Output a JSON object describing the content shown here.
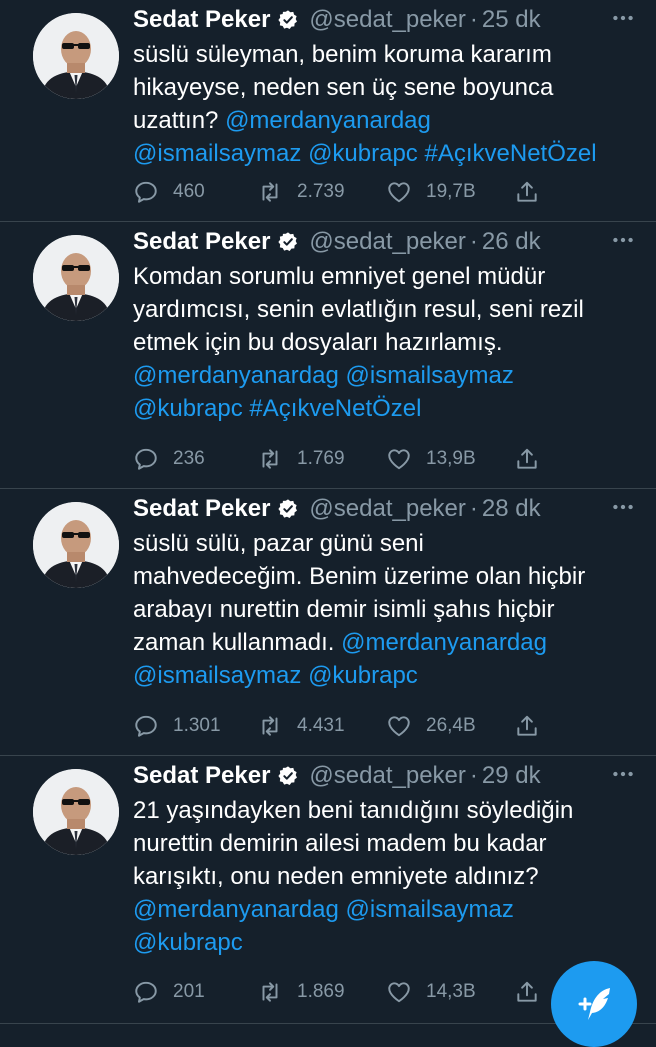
{
  "tweets": [
    {
      "author": {
        "name": "Sedat Peker",
        "handle": "@sedat_peker",
        "verified": true
      },
      "separator": "·",
      "time": "25 dk",
      "lines": [
        [
          {
            "text": "süslü süleyman, benim koruma kararım"
          }
        ],
        [
          {
            "text": "hikayeyse, neden sen üç sene boyunca"
          }
        ],
        [
          {
            "text": "uzattın? "
          },
          {
            "text": "@merdanyanardag",
            "link": true
          }
        ],
        [
          {
            "text": "@ismailsaymaz",
            "link": true
          },
          {
            "text": " "
          },
          {
            "text": "@kubrapc",
            "link": true
          },
          {
            "text": " "
          },
          {
            "text": "#AçıkveNetÖzel",
            "link": true
          }
        ]
      ],
      "stats": {
        "replies": "460",
        "retweets": "2.739",
        "likes": "19,7B"
      }
    },
    {
      "author": {
        "name": "Sedat Peker",
        "handle": "@sedat_peker",
        "verified": true
      },
      "separator": "·",
      "time": "26 dk",
      "lines": [
        [
          {
            "text": "Komdan sorumlu emniyet genel müdür"
          }
        ],
        [
          {
            "text": "yardımcısı, senin evlatlığın resul, seni rezil"
          }
        ],
        [
          {
            "text": "etmek için bu dosyaları hazırlamış."
          }
        ],
        [
          {
            "text": "@merdanyanardag",
            "link": true
          },
          {
            "text": " "
          },
          {
            "text": "@ismailsaymaz",
            "link": true
          }
        ],
        [
          {
            "text": "@kubrapc",
            "link": true
          },
          {
            "text": " "
          },
          {
            "text": "#AçıkveNetÖzel",
            "link": true
          }
        ]
      ],
      "stats": {
        "replies": "236",
        "retweets": "1.769",
        "likes": "13,9B"
      }
    },
    {
      "author": {
        "name": "Sedat Peker",
        "handle": "@sedat_peker",
        "verified": true
      },
      "separator": "·",
      "time": "28 dk",
      "lines": [
        [
          {
            "text": "süslü sülü, pazar günü seni"
          }
        ],
        [
          {
            "text": "mahvedeceğim. Benim üzerime olan hiçbir"
          }
        ],
        [
          {
            "text": "arabayı nurettin demir isimli şahıs hiçbir"
          }
        ],
        [
          {
            "text": "zaman kullanmadı. "
          },
          {
            "text": "@merdanyanardag",
            "link": true
          }
        ],
        [
          {
            "text": "@ismailsaymaz",
            "link": true
          },
          {
            "text": " "
          },
          {
            "text": "@kubrapc",
            "link": true
          }
        ]
      ],
      "stats": {
        "replies": "1.301",
        "retweets": "4.431",
        "likes": "26,4B"
      }
    },
    {
      "author": {
        "name": "Sedat Peker",
        "handle": "@sedat_peker",
        "verified": true
      },
      "separator": "·",
      "time": "29 dk",
      "lines": [
        [
          {
            "text": "21 yaşındayken beni tanıdığını söylediğin"
          }
        ],
        [
          {
            "text": "nurettin demirin ailesi madem bu kadar"
          }
        ],
        [
          {
            "text": "karışıktı, onu neden emniyete aldınız?"
          }
        ],
        [
          {
            "text": "@merdanyanardag",
            "link": true
          },
          {
            "text": " "
          },
          {
            "text": "@ismailsaymaz",
            "link": true
          }
        ],
        [
          {
            "text": "@kubrapc",
            "link": true
          }
        ]
      ],
      "stats": {
        "replies": "201",
        "retweets": "1.869",
        "likes": "14,3B"
      }
    }
  ],
  "colors": {
    "background": "#15202b",
    "text": "#ffffff",
    "secondary": "#8899a6",
    "accent": "#1d9bf0",
    "divider": "#38444d"
  },
  "icons": {
    "reply": "reply-icon",
    "retweet": "retweet-icon",
    "like": "like-icon",
    "share": "share-icon",
    "more": "more-icon",
    "verified": "verified-badge-icon",
    "compose": "compose-tweet-icon"
  }
}
